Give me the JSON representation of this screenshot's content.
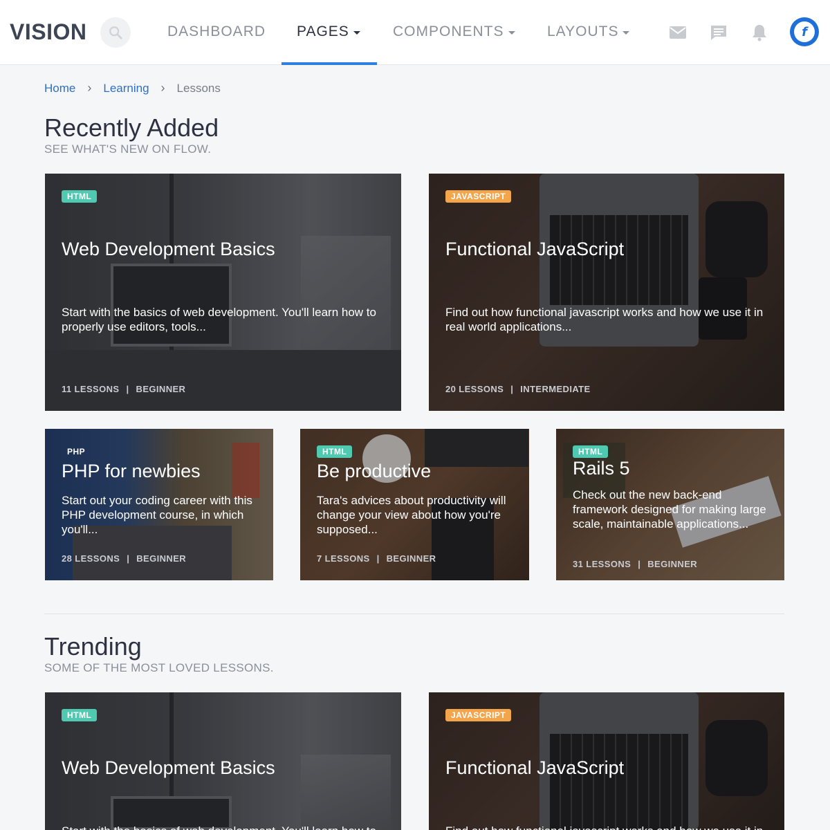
{
  "brand": {
    "logo_text": "VISION"
  },
  "nav": {
    "items": [
      {
        "label": "DASHBOARD",
        "has_dropdown": false,
        "active": false
      },
      {
        "label": "PAGES",
        "has_dropdown": true,
        "active": true
      },
      {
        "label": "COMPONENTS",
        "has_dropdown": true,
        "active": false
      },
      {
        "label": "LAYOUTS",
        "has_dropdown": true,
        "active": false
      }
    ],
    "icons": [
      "search-icon",
      "mail-icon",
      "chat-icon",
      "bell-icon",
      "user-avatar"
    ]
  },
  "colors": {
    "accent": "#2f7fe0",
    "tag_html": "#4fc9b0",
    "tag_javascript": "#f2a54a",
    "link": "#2f6fc6"
  },
  "breadcrumb": {
    "items": [
      {
        "label": "Home",
        "link": true
      },
      {
        "label": "Learning",
        "link": true
      },
      {
        "label": "Lessons",
        "link": false
      }
    ]
  },
  "recent": {
    "title": "Recently Added",
    "subtitle": "SEE WHAT'S NEW ON FLOW.",
    "cards": [
      {
        "tag": "HTML",
        "title": "Web Development Basics",
        "description": "Start with the basics of web development. You'll learn how to properly use editors, tools...",
        "lessons": "11 LESSONS",
        "level": "BEGINNER"
      },
      {
        "tag": "JAVASCRIPT",
        "title": "Functional JavaScript",
        "description": "Find out how functional javascript works and how we use it in real world applications...",
        "lessons": "20 LESSONS",
        "level": "INTERMEDIATE"
      },
      {
        "tag": "PHP",
        "title": "PHP for newbies",
        "description": "Start out your coding career with this PHP development course, in which you'll...",
        "lessons": "28 LESSONS",
        "level": "BEGINNER"
      },
      {
        "tag": "HTML",
        "title": "Be productive",
        "description": "Tara's advices about productivity will change your view about how you're supposed...",
        "lessons": "7 LESSONS",
        "level": "BEGINNER"
      },
      {
        "tag": "HTML",
        "title": "Rails 5",
        "description": "Check out the new back-end framework designed for making large scale, maintainable applications...",
        "lessons": "31 LESSONS",
        "level": "BEGINNER"
      }
    ]
  },
  "trending": {
    "title": "Trending",
    "subtitle": "SOME OF THE MOST LOVED LESSONS.",
    "cards": [
      {
        "tag": "HTML",
        "title": "Web Development Basics",
        "description": "Start with the basics of web development. You'll learn how to properly use editors, tools..."
      },
      {
        "tag": "JAVASCRIPT",
        "title": "Functional JavaScript",
        "description": "Find out how functional javascript works and how we use it in real world applications..."
      }
    ]
  }
}
